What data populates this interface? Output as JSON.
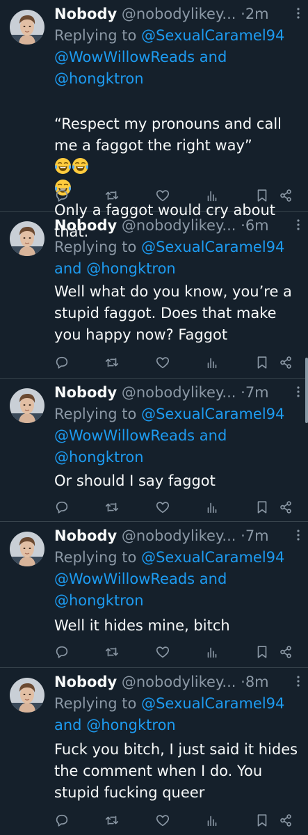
{
  "colors": {
    "background": "#15202b",
    "text": "#f7f9f9",
    "secondary": "#8b98a5",
    "mention": "#1d9bf0",
    "divider": "#38444d"
  },
  "icons": {
    "reply": "comment-icon",
    "retweet": "retweet-icon",
    "like": "heart-icon",
    "views": "views-icon",
    "bookmark": "bookmark-icon",
    "share": "share-icon",
    "more": "more-icon",
    "emoji": "tears-of-joy-emoji"
  },
  "tweets": [
    {
      "name": "Nobody",
      "handle": "@nobodylikey...",
      "dot": "·",
      "time": "2m",
      "replying_prefix": "Replying to",
      "mention_1": "@SexualCaramel94",
      "mention_2": "@WowWillowReads",
      "joiner": "and",
      "mention_3": "@hongktron",
      "text_part_1": "“Respect my pronouns and call me a faggot the right way”",
      "text_part_2": "Only a faggot would cry about that."
    },
    {
      "name": "Nobody",
      "handle": "@nobodylikey...",
      "dot": "·",
      "time": "6m",
      "replying_prefix": "Replying to",
      "mention_1": "@SexualCaramel94",
      "joiner": "and",
      "mention_3": "@hongktron",
      "text": "Well what do you know, you’re a stupid faggot. Does that make you happy now? Faggot"
    },
    {
      "name": "Nobody",
      "handle": "@nobodylikey...",
      "dot": "·",
      "time": "7m",
      "replying_prefix": "Replying to",
      "mention_1": "@SexualCaramel94",
      "mention_2": "@WowWillowReads",
      "joiner": "and",
      "mention_3": "@hongktron",
      "text": "Or should I say faggot"
    },
    {
      "name": "Nobody",
      "handle": "@nobodylikey...",
      "dot": "·",
      "time": "7m",
      "replying_prefix": "Replying to",
      "mention_1": "@SexualCaramel94",
      "mention_2": "@WowWillowReads",
      "joiner": "and",
      "mention_3": "@hongktron",
      "text": "Well it hides mine, bitch"
    },
    {
      "name": "Nobody",
      "handle": "@nobodylikey...",
      "dot": "·",
      "time": "8m",
      "replying_prefix": "Replying to",
      "mention_1": "@SexualCaramel94",
      "joiner": "and",
      "mention_3": "@hongktron",
      "text": "Fuck you bitch, I just said it hides the comment when I do. You stupid fucking queer"
    }
  ]
}
